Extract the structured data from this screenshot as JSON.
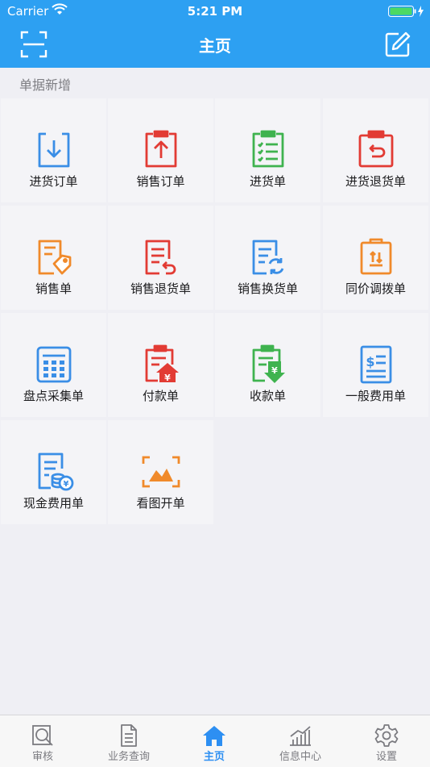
{
  "status": {
    "carrier": "Carrier",
    "time": "5:21 PM"
  },
  "nav": {
    "title": "主页"
  },
  "section": {
    "title": "单据新增"
  },
  "items": [
    {
      "label": "进货订单",
      "icon": "purchase-order-icon",
      "color": "#3a8ee6"
    },
    {
      "label": "销售订单",
      "icon": "sales-order-icon",
      "color": "#e23b34"
    },
    {
      "label": "进货单",
      "icon": "purchase-receipt-icon",
      "color": "#3fb34f"
    },
    {
      "label": "进货退货单",
      "icon": "purchase-return-icon",
      "color": "#e23b34"
    },
    {
      "label": "销售单",
      "icon": "sales-invoice-icon",
      "color": "#f08a2b"
    },
    {
      "label": "销售退货单",
      "icon": "sales-return-icon",
      "color": "#e23b34"
    },
    {
      "label": "销售换货单",
      "icon": "sales-exchange-icon",
      "color": "#3a8ee6"
    },
    {
      "label": "同价调拨单",
      "icon": "transfer-icon",
      "color": "#f08a2b"
    },
    {
      "label": "盘点采集单",
      "icon": "inventory-count-icon",
      "color": "#3a8ee6"
    },
    {
      "label": "付款单",
      "icon": "payment-icon",
      "color": "#e23b34"
    },
    {
      "label": "收款单",
      "icon": "receipt-icon",
      "color": "#3fb34f"
    },
    {
      "label": "一般费用单",
      "icon": "general-expense-icon",
      "color": "#3a8ee6"
    },
    {
      "label": "现金费用单",
      "icon": "cash-expense-icon",
      "color": "#3a8ee6"
    },
    {
      "label": "看图开单",
      "icon": "image-order-icon",
      "color": "#f08a2b"
    }
  ],
  "tabs": [
    {
      "label": "审核",
      "icon": "audit-icon",
      "active": false
    },
    {
      "label": "业务查询",
      "icon": "document-icon",
      "active": false
    },
    {
      "label": "主页",
      "icon": "home-icon",
      "active": true
    },
    {
      "label": "信息中心",
      "icon": "chart-icon",
      "active": false
    },
    {
      "label": "设置",
      "icon": "gear-icon",
      "active": false
    }
  ],
  "colors": {
    "nav": "#2da0f2",
    "active_tab": "#2d8ff2"
  }
}
